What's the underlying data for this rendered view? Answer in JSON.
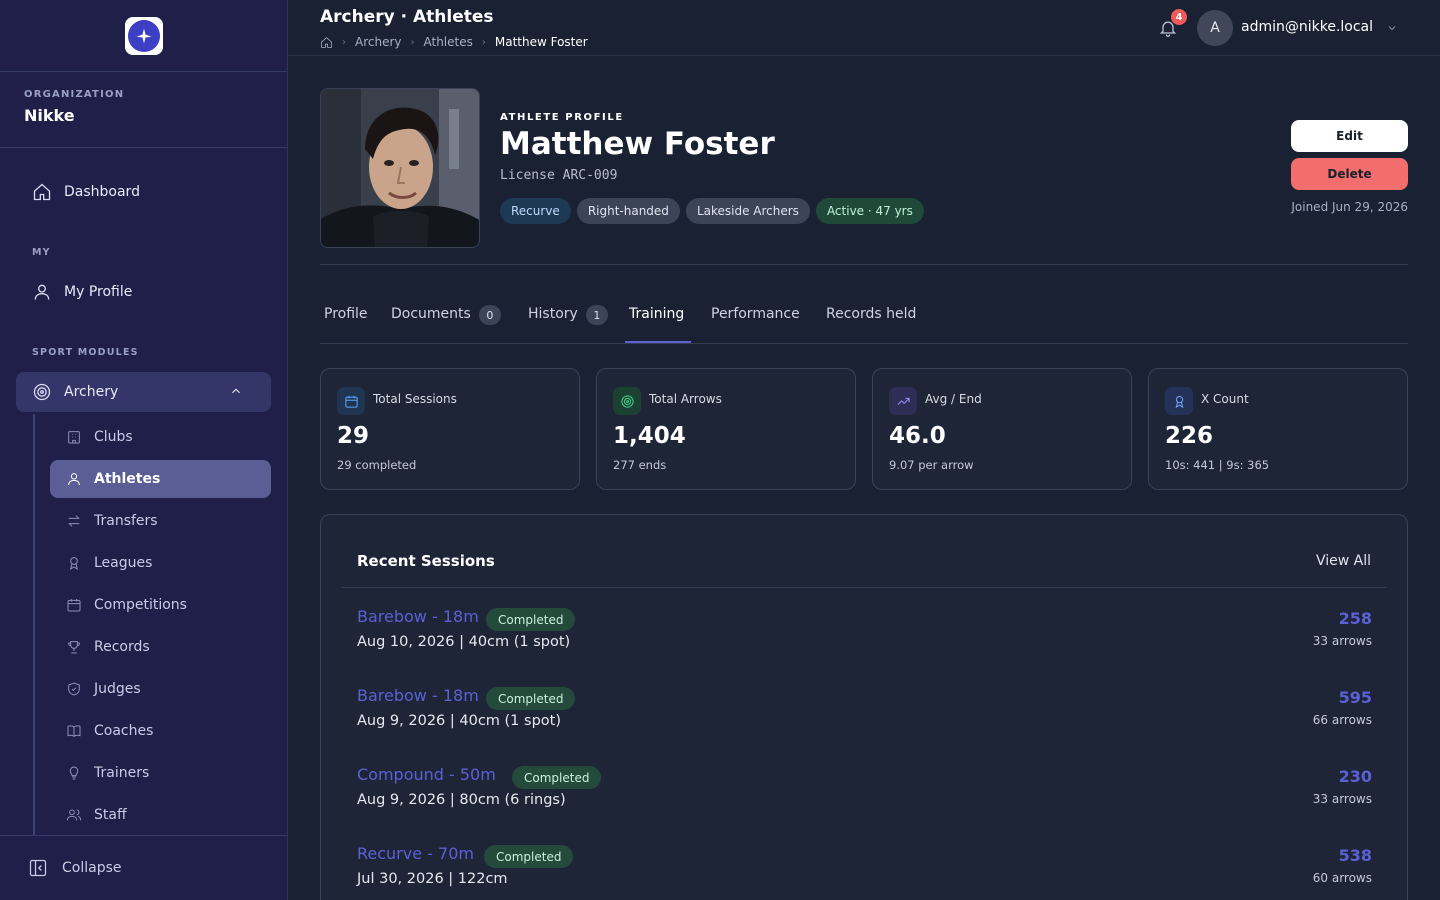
{
  "sidebar": {
    "org_label": "ORGANIZATION",
    "org_name": "Nikke",
    "dashboard": "Dashboard",
    "my_label": "MY",
    "my_profile": "My Profile",
    "sport_label": "SPORT MODULES",
    "archery": "Archery",
    "sub_items": [
      "Clubs",
      "Athletes",
      "Transfers",
      "Leagues",
      "Competitions",
      "Records",
      "Judges",
      "Coaches",
      "Trainers",
      "Staff"
    ],
    "collapse": "Collapse"
  },
  "topbar": {
    "title": "Archery · Athletes",
    "crumbs": [
      "Archery",
      "Athletes",
      "Matthew Foster"
    ],
    "notifications": "4",
    "avatar_initial": "A",
    "user_email": "admin@nikke.local"
  },
  "profile": {
    "eyebrow": "ATHLETE PROFILE",
    "name": "Matthew Foster",
    "license": "License ARC-009",
    "tags": [
      "Recurve",
      "Right-handed",
      "Lakeside Archers",
      "Active · 47 yrs"
    ],
    "edit": "Edit",
    "delete": "Delete",
    "joined": "Joined Jun 29, 2026"
  },
  "tabs": [
    {
      "label": "Profile"
    },
    {
      "label": "Documents",
      "count": "0"
    },
    {
      "label": "History",
      "count": "1"
    },
    {
      "label": "Training"
    },
    {
      "label": "Performance"
    },
    {
      "label": "Records held"
    }
  ],
  "stats": [
    {
      "label": "Total Sessions",
      "value": "29",
      "sub": "29 completed",
      "icon": "calendar-icon",
      "color": "#5aa7ff"
    },
    {
      "label": "Total Arrows",
      "value": "1,404",
      "sub": "277 ends",
      "icon": "target-icon",
      "color": "#3fd38a"
    },
    {
      "label": "Avg / End",
      "value": "46.0",
      "sub": "9.07 per arrow",
      "icon": "trend-up-icon",
      "color": "#9b8cff"
    },
    {
      "label": "X Count",
      "value": "226",
      "sub": "10s: 441 | 9s: 365",
      "icon": "award-icon",
      "color": "#6ea8ff"
    }
  ],
  "recent": {
    "title": "Recent Sessions",
    "view_all": "View All",
    "sessions": [
      {
        "name": "Barebow - 18m",
        "status": "Completed",
        "detail": "Aug 10, 2026 | 40cm (1 spot)",
        "score": "258",
        "arrows": "33 arrows"
      },
      {
        "name": "Barebow - 18m",
        "status": "Completed",
        "detail": "Aug 9, 2026 | 40cm (1 spot)",
        "score": "595",
        "arrows": "66 arrows"
      },
      {
        "name": "Compound - 50m",
        "status": "Completed",
        "detail": "Aug 9, 2026 | 80cm (6 rings)",
        "score": "230",
        "arrows": "33 arrows"
      },
      {
        "name": "Recurve - 70m",
        "status": "Completed",
        "detail": "Jul 30, 2026 | 122cm",
        "score": "538",
        "arrows": "60 arrows"
      }
    ]
  },
  "colors": {
    "accent": "#5b60d6",
    "sidebar_bg": "#1f1f4a",
    "page_bg": "#1a2132",
    "danger": "#f26d6d"
  }
}
